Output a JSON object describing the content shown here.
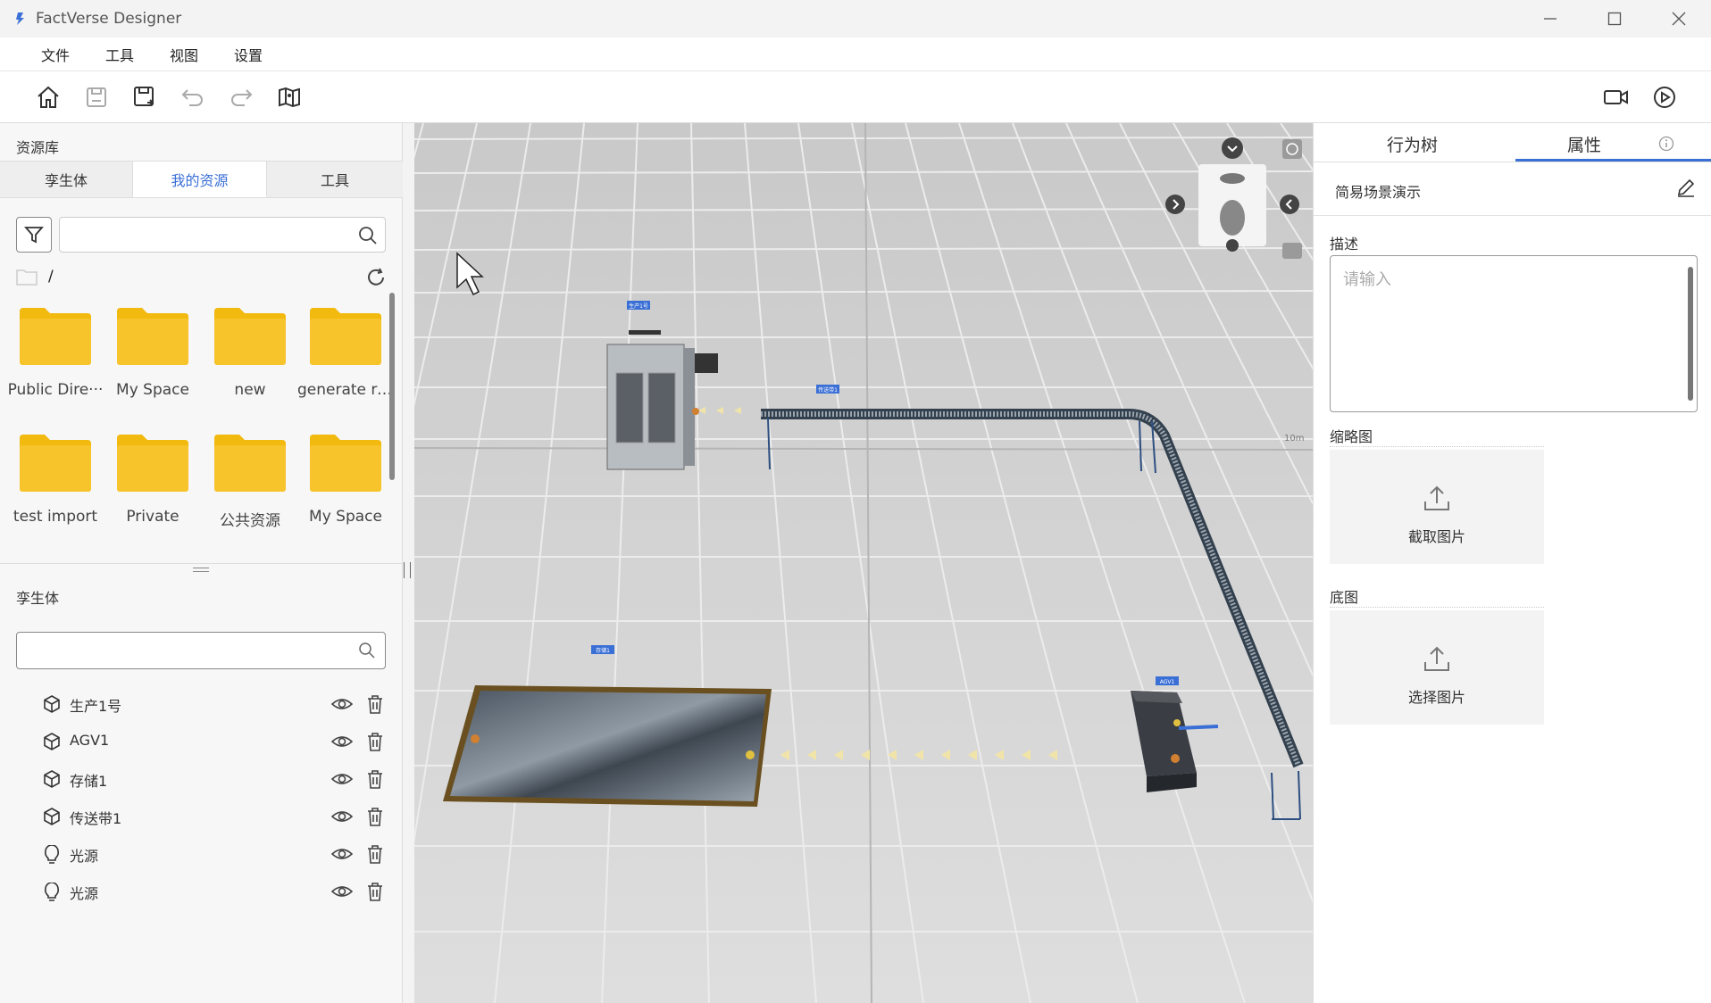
{
  "app": {
    "title": "FactVerse Designer"
  },
  "menu": [
    "文件",
    "工具",
    "视图",
    "设置"
  ],
  "toolbar": {
    "left_icons": [
      "home-icon",
      "save-icon",
      "save-as-icon",
      "undo-icon",
      "redo-icon",
      "map-icon"
    ],
    "right_icons": [
      "video-camera-icon",
      "play-icon"
    ]
  },
  "resource_panel": {
    "title": "资源库",
    "tabs": [
      {
        "label": "孪生体",
        "active": false
      },
      {
        "label": "我的资源",
        "active": true
      },
      {
        "label": "工具",
        "active": false
      }
    ],
    "search": {
      "value": "",
      "placeholder": ""
    },
    "path": "/",
    "folders": [
      "Public Dire···",
      "My Space",
      "new",
      "generate re···",
      "test import",
      "Private",
      "公共资源",
      "My Space"
    ]
  },
  "twin_panel": {
    "title": "孪生体",
    "search": {
      "value": "",
      "placeholder": ""
    },
    "items": [
      {
        "label": "生产1号",
        "icon": "cube-icon"
      },
      {
        "label": "AGV1",
        "icon": "cube-icon"
      },
      {
        "label": "存储1",
        "icon": "cube-icon"
      },
      {
        "label": "传送带1",
        "icon": "cube-icon"
      },
      {
        "label": "光源",
        "icon": "lightbulb-icon"
      },
      {
        "label": "光源",
        "icon": "lightbulb-icon"
      }
    ]
  },
  "viewport": {
    "scene_labels": [
      "生产1号",
      "传送带1",
      "存储1",
      "AGV1"
    ],
    "scale_label": "10m"
  },
  "properties_panel": {
    "tabs": [
      {
        "label": "行为树",
        "active": false
      },
      {
        "label": "属性",
        "active": true
      }
    ],
    "scene_name": "简易场景演示",
    "description_label": "描述",
    "description": {
      "value": "",
      "placeholder": "请输入"
    },
    "thumbnail_label": "缩略图",
    "thumbnail_button": "截取图片",
    "base_map_label": "底图",
    "base_map_button": "选择图片"
  },
  "colors": {
    "accent": "#3a6fd6",
    "folder": "#f8c22a",
    "grid": "#d6d6d6"
  }
}
